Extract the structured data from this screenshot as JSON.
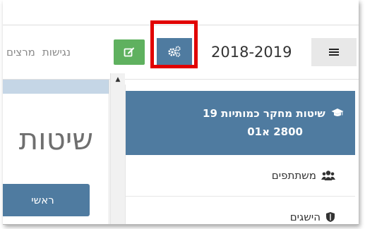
{
  "navbar": {
    "links": [
      "מרצים",
      "נגישות"
    ],
    "year": "2018-2019"
  },
  "content": {
    "title": "שיטות",
    "main_button": "ראשי"
  },
  "sidebar": {
    "course_title_line1": "שיטות מחקר כמותיות 19",
    "course_title_line2": "2800 א01",
    "items": [
      {
        "label": "משתתפים",
        "icon": "users-icon"
      },
      {
        "label": "הישגים",
        "icon": "shield-icon"
      }
    ]
  },
  "colors": {
    "primary": "#4f7ba0",
    "success": "#5fb15f",
    "highlight": "#e10000"
  }
}
